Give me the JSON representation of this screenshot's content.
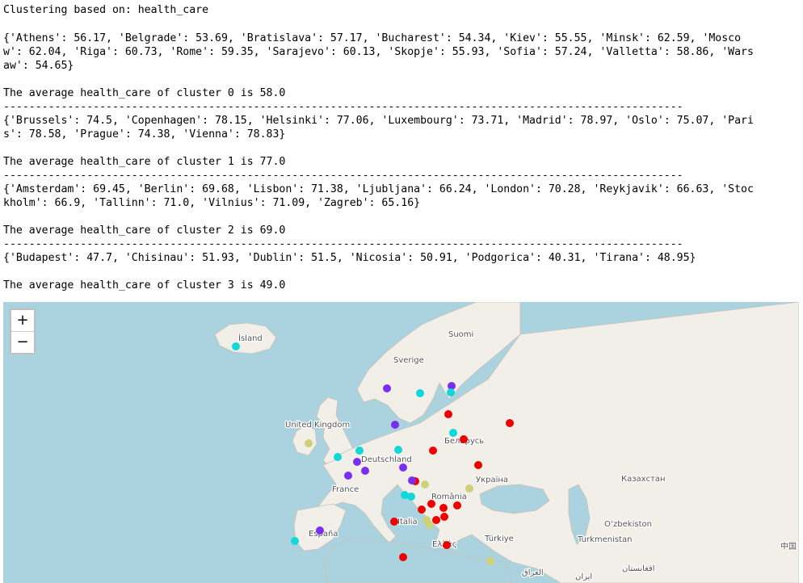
{
  "output": {
    "header": "Clustering based on: health_care",
    "clusters": [
      {
        "lines": [
          "{'Athens': 56.17, 'Belgrade': 53.69, 'Bratislava': 57.17, 'Bucharest': 54.34, 'Kiev': 55.55, 'Minsk': 62.59, 'Mosco",
          "w': 62.04, 'Riga': 60.73, 'Rome': 59.35, 'Sarajevo': 60.13, 'Skopje': 55.93, 'Sofia': 57.24, 'Valletta': 58.86, 'Wars",
          "aw': 54.65}"
        ],
        "average": "The average health_care of cluster 0 is 58.0"
      },
      {
        "lines": [
          "{'Brussels': 74.5, 'Copenhagen': 78.15, 'Helsinki': 77.06, 'Luxembourg': 73.71, 'Madrid': 78.97, 'Oslo': 75.07, 'Pari",
          "s': 78.58, 'Prague': 74.38, 'Vienna': 78.83}"
        ],
        "average": "The average health_care of cluster 1 is 77.0"
      },
      {
        "lines": [
          "{'Amsterdam': 69.45, 'Berlin': 69.68, 'Lisbon': 71.38, 'Ljubljana': 66.24, 'London': 70.28, 'Reykjavik': 66.63, 'Stoc",
          "kholm': 66.9, 'Tallinn': 71.0, 'Vilnius': 71.09, 'Zagreb': 65.16}"
        ],
        "average": "The average health_care of cluster 2 is 69.0"
      },
      {
        "lines": [
          "{'Budapest': 47.7, 'Chisinau': 51.93, 'Dublin': 51.5, 'Nicosia': 50.91, 'Podgorica': 40.31, 'Tirana': 48.95}"
        ],
        "average": "The average health_care of cluster 3 is 49.0"
      }
    ],
    "separator": "----------------------------------------------------------------------------------------------------------"
  },
  "map": {
    "zoom_in": "+",
    "zoom_out": "−",
    "labels": {
      "island": "Ísland",
      "suomi": "Suomi",
      "sverige": "Sverige",
      "uk": "United Kingdom",
      "belarus": "Беларусь",
      "deutschland": "Deutschland",
      "ukraina": "Україна",
      "kazakhstan": "Казахстан",
      "france": "France",
      "romania": "România",
      "italia": "Italia",
      "espana": "España",
      "turkiye": "Türkiye",
      "uzbekistan": "O‘zbekiston",
      "turkmenistan": "Turkmenistan",
      "ellada": "Ελλάς",
      "china": "中国",
      "iraq": "العراق",
      "iran": "ایران",
      "afghanistan": "افغانستان"
    },
    "cluster_colors": {
      "cluster_0": "#ee0000",
      "cluster_1": "#7a2ff0",
      "cluster_2": "#10d8d8",
      "cluster_3": "#cfd07a"
    },
    "land_color": "#f2efe9",
    "sea_color": "#aad3df"
  }
}
